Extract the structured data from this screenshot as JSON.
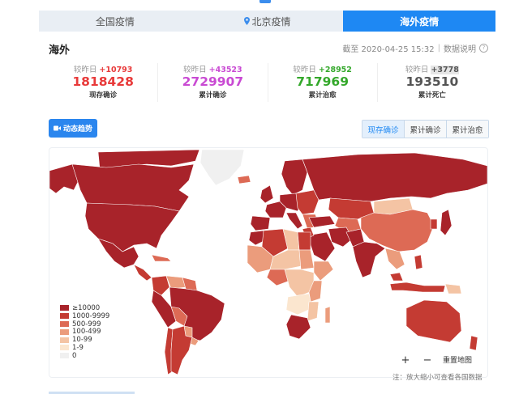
{
  "tabs": [
    {
      "label": "全国疫情"
    },
    {
      "label": "北京疫情"
    },
    {
      "label": "海外疫情"
    }
  ],
  "header": {
    "region": "海外",
    "updated": "截至 2020-04-25 15:32",
    "help_label": "数据说明"
  },
  "stats": [
    {
      "delta_label": "较昨日",
      "delta": "+10793",
      "value": "1818428",
      "label": "现存确诊",
      "color": "#e83a3a"
    },
    {
      "delta_label": "较昨日",
      "delta": "+43523",
      "value": "2729907",
      "label": "累计确诊",
      "color": "#c94ad3"
    },
    {
      "delta_label": "较昨日",
      "delta": "+28952",
      "value": "717969",
      "label": "累计治愈",
      "color": "#34a82b"
    },
    {
      "delta_label": "较昨日",
      "delta": "+3778",
      "value": "193510",
      "label": "累计死亡",
      "color": "#555555"
    }
  ],
  "trend_button": "动态趋势",
  "map_tabs": [
    {
      "label": "现存确诊"
    },
    {
      "label": "累计确诊"
    },
    {
      "label": "累计治愈"
    }
  ],
  "legend": [
    {
      "label": "≥10000",
      "color": "#a8232a"
    },
    {
      "label": "1000-9999",
      "color": "#c43b33"
    },
    {
      "label": "500-999",
      "color": "#dd6a55"
    },
    {
      "label": "100-499",
      "color": "#eb9c7c"
    },
    {
      "label": "10-99",
      "color": "#f4c4a4"
    },
    {
      "label": "1-9",
      "color": "#fbe6cf"
    },
    {
      "label": "0",
      "color": "#f0f0f0"
    }
  ],
  "zoom_in": "+",
  "zoom_out": "−",
  "reset_map": "重置地图",
  "map_note": "注：放大缩小可查看各国数据",
  "colors": {
    "accent": "#1e88f3"
  }
}
